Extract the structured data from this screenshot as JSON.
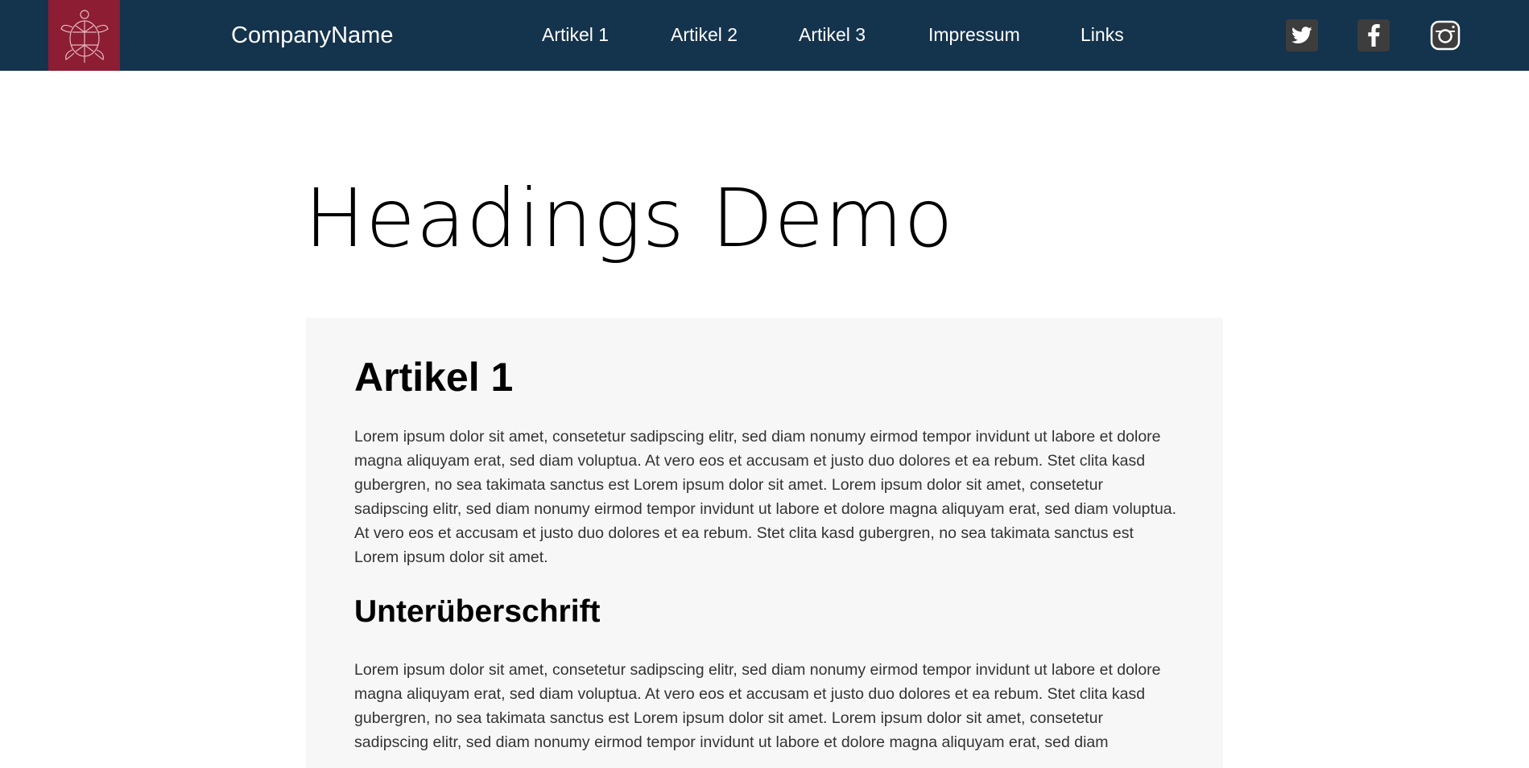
{
  "header": {
    "brand": "CompanyName",
    "nav": [
      "Artikel 1",
      "Artikel 2",
      "Artikel 3",
      "Impressum",
      "Links"
    ],
    "logo_icon": "turtle-icon",
    "social": [
      "twitter-icon",
      "facebook-icon",
      "instagram-icon"
    ]
  },
  "main": {
    "title": "Headings Demo",
    "article": {
      "heading": "Artikel 1",
      "paragraph1": "Lorem ipsum dolor sit amet, consetetur sadipscing elitr, sed diam nonumy eirmod tempor invidunt ut labore et dolore magna aliquyam erat, sed diam voluptua. At vero eos et accusam et justo duo dolores et ea rebum. Stet clita kasd gubergren, no sea takimata sanctus est Lorem ipsum dolor sit amet. Lorem ipsum dolor sit amet, consetetur sadipscing elitr, sed diam nonumy eirmod tempor invidunt ut labore et dolore magna aliquyam erat, sed diam voluptua. At vero eos et accusam et justo duo dolores et ea rebum. Stet clita kasd gubergren, no sea takimata sanctus est Lorem ipsum dolor sit amet.",
      "subheading": "Unterüberschrift",
      "paragraph2": "Lorem ipsum dolor sit amet, consetetur sadipscing elitr, sed diam nonumy eirmod tempor invidunt ut labore et dolore magna aliquyam erat, sed diam voluptua. At vero eos et accusam et justo duo dolores et ea rebum. Stet clita kasd gubergren, no sea takimata sanctus est Lorem ipsum dolor sit amet. Lorem ipsum dolor sit amet, consetetur sadipscing elitr, sed diam nonumy eirmod tempor invidunt ut labore et dolore magna aliquyam erat, sed diam"
    }
  },
  "colors": {
    "header_bg": "#14334d",
    "logo_bg": "#8c1d32",
    "article_bg": "#f7f7f7",
    "social_bg": "#3d3d3d"
  }
}
